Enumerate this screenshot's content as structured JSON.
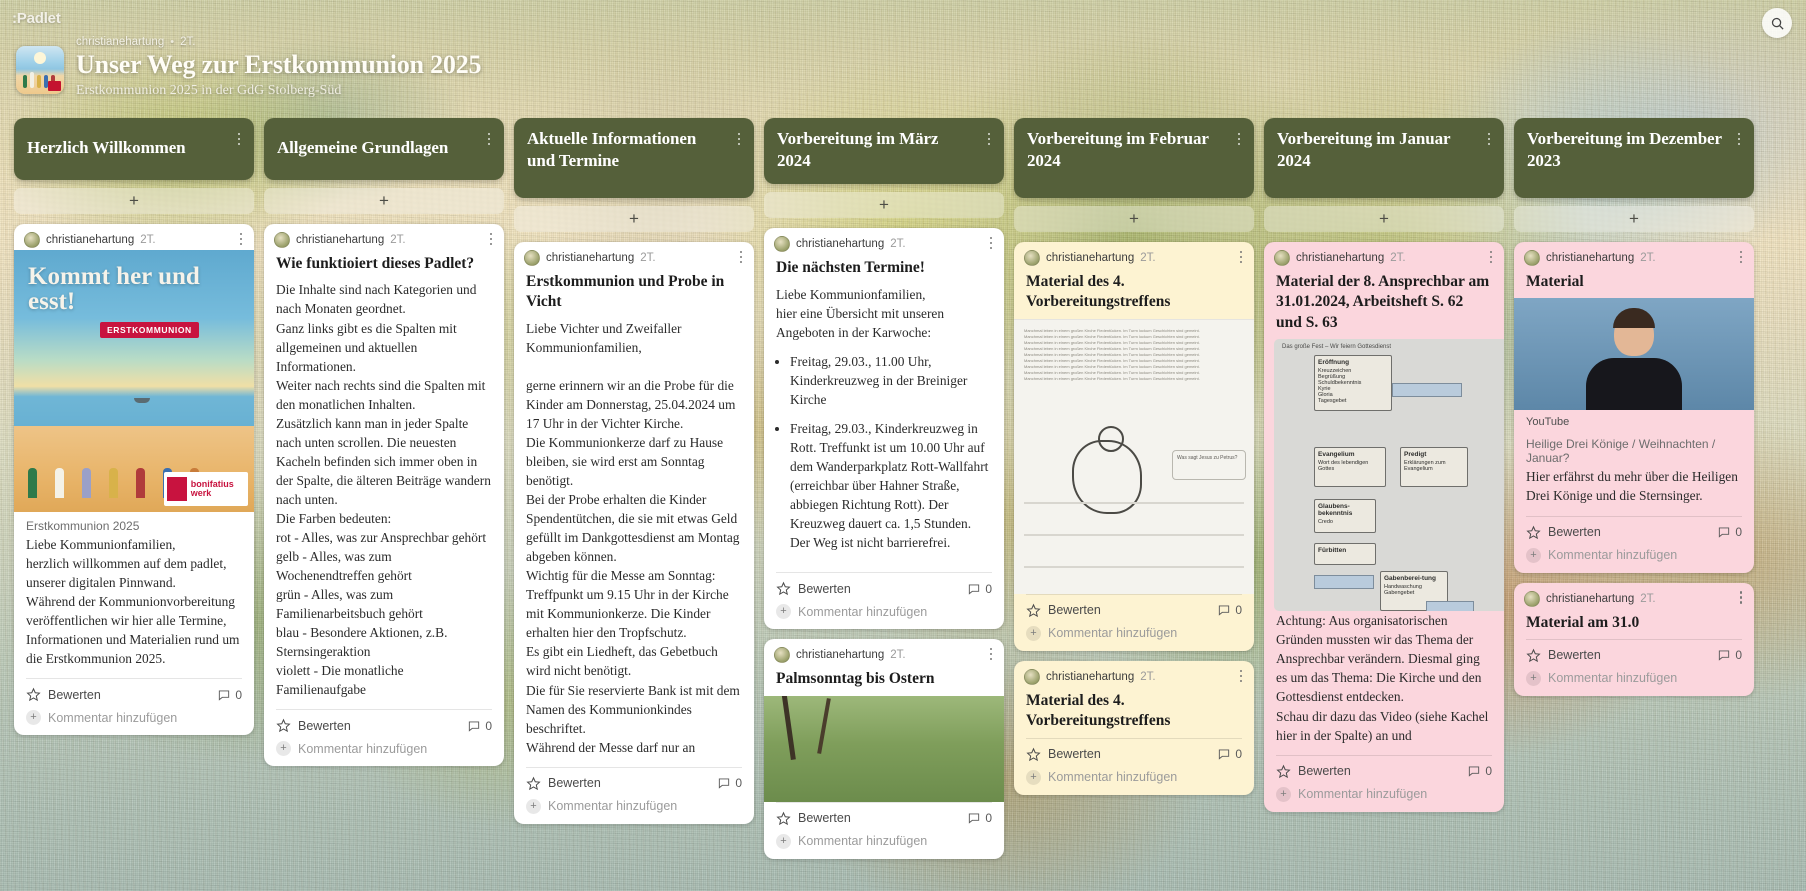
{
  "app": {
    "logo": ":Padlet",
    "search_icon": "search-icon"
  },
  "board": {
    "author": "christianehartung",
    "separator": "•",
    "time": "2T.",
    "title": "Unser Weg zur Erstkommunion 2025",
    "subtitle": "Erstkommunion 2025 in der GdG Stolberg-Süd"
  },
  "ui": {
    "add_label": "+",
    "rate_label": "Bewerten",
    "add_comment_label": "Kommentar hinzufügen",
    "comment_count": "0",
    "author": "christianehartung",
    "time": "2T.",
    "accent_header": "#55603a",
    "card_white": "#ffffff",
    "card_cream": "#fdf3d2",
    "card_pink": "#fbd6dd"
  },
  "columns": [
    {
      "title": "Herzlich Willkommen",
      "cards": [
        {
          "color": "white",
          "media": "communion-cover-image",
          "media_headline": "Kommt her und esst!",
          "media_badge": "ERSTKOMMUNION",
          "media_logo": "bonifatius werk",
          "caption": "Erstkommunion 2025",
          "body": "Liebe Kommunionfamilien,\nherzlich willkommen auf dem padlet, unserer digitalen Pinnwand.\nWährend der Kommunionvorbereitung veröffentlichen wir hier alle Termine, Informationen und Materialien rund um die Erstkommunion 2025."
        }
      ]
    },
    {
      "title": "Allgemeine Grundlagen",
      "cards": [
        {
          "color": "white",
          "title": "Wie funktioiert dieses Padlet?",
          "body": "Die Inhalte sind nach Kategorien und nach Monaten geordnet.\nGanz links gibt es die Spalten mit allgemeinen und aktuellen Informationen.\nWeiter nach rechts sind die Spalten mit den monatlichen Inhalten.\nZusätzlich kann man in jeder Spalte nach unten scrollen. Die neuesten Kacheln befinden sich immer oben in der Spalte, die älteren Beiträge wandern nach unten.\nDie Farben bedeuten:\nrot - Alles, was zur Ansprechbar gehört\ngelb - Alles, was zum Wochenendtreffen gehört\ngrün - Alles, was zum Familienarbeitsbuch gehört\nblau - Besondere Aktionen, z.B. Sternsingeraktion\nviolett - Die monatliche Familienaufgabe",
          "footer_rate": "Bewerten"
        }
      ]
    },
    {
      "title": "Aktuelle Informationen und Termine",
      "cards": [
        {
          "color": "white",
          "title": "Erstkommunion und Probe in Vicht",
          "body": "Liebe Vichter und Zweifaller Kommunionfamilien,\n\ngerne erinnern wir an die Probe für die Kinder am Donnerstag, 25.04.2024 um 17 Uhr in der Vichter Kirche.\nDie Kommunionkerze darf zu Hause bleiben, sie wird erst am Sonntag benötigt.\nBei der Probe erhalten die Kinder Spendentütchen, die sie mit etwas Geld gefüllt im Dankgottesdienst am Montag abgeben können.\nWichtig für die Messe am Sonntag: Treffpunkt um 9.15 Uhr in der Kirche mit Kommunionkerze. Die Kinder erhalten hier den Tropfschutz.\nEs gibt ein Liedheft, das Gebetbuch wird nicht benötigt.\nDie für Sie reservierte Bank ist mit dem Namen des Kommunionkindes beschriftet.\nWährend der Messe darf nur an"
        }
      ]
    },
    {
      "title": "Vorbereitung im März 2024",
      "cards": [
        {
          "color": "white",
          "title": "Die nächsten Termine!",
          "body": "Liebe Kommunionfamilien,\nhier eine Übersicht mit unseren Angeboten in der Karwoche:",
          "list": [
            "Freitag, 29.03., 11.00 Uhr, Kinderkreuzweg in der Breiniger Kirche",
            "Freitag, 29.03., Kinderkreuzweg in Rott. Treffunkt ist um 10.00 Uhr auf dem Wanderparkplatz Rott-Wallfahrt (erreichbar über Hahner Straße, abbiegen Richtung Rott). Der Kreuzweg dauert ca. 1,5 Stunden. Der Weg ist nicht barrierefrei."
          ]
        },
        {
          "color": "white",
          "title": "Palmsonntag bis Ostern",
          "media": "meadow-photo"
        }
      ]
    },
    {
      "title": "Vorbereitung im Februar 2024",
      "cards": [
        {
          "color": "cream",
          "title": "Material des 4. Vorbereitungstreffens",
          "media": "worksheet-document",
          "media_caption": "Was sagt Jesus zu Petrus?"
        },
        {
          "color": "cream",
          "title": "Material des 4. Vorbereitungstreffens"
        }
      ]
    },
    {
      "title": "Vorbereitung im Januar 2024",
      "cards": [
        {
          "color": "pink",
          "title": "Material der 8. Ansprechbar am 31.01.2024, Arbeitsheft S. 62 und S. 63",
          "media": "mass-structure-diagram",
          "media_title": "Das große Fest – Wir feiern Gottesdienst",
          "body": "Achtung: Aus organisatorischen Gründen mussten wir das Thema der Ansprechbar verändern. Diesmal ging es um das Thema: Die Kirche und den Gottesdienst entdecken.\nSchau dir dazu das Video (siehe Kachel hier in der Spalte) an und"
        }
      ]
    },
    {
      "title": "Vorbereitung im Dezember 2023",
      "cards": [
        {
          "color": "pink",
          "title": "Material",
          "media": "youtube-video",
          "video_tag": "YouTube",
          "caption": "Heilige Drei Könige / Weihnachten / Januar?",
          "body": "Hier erfährst du mehr über die Heiligen Drei Könige und die Sternsinger."
        },
        {
          "color": "pink",
          "title": "Material am 31.0"
        }
      ]
    }
  ]
}
